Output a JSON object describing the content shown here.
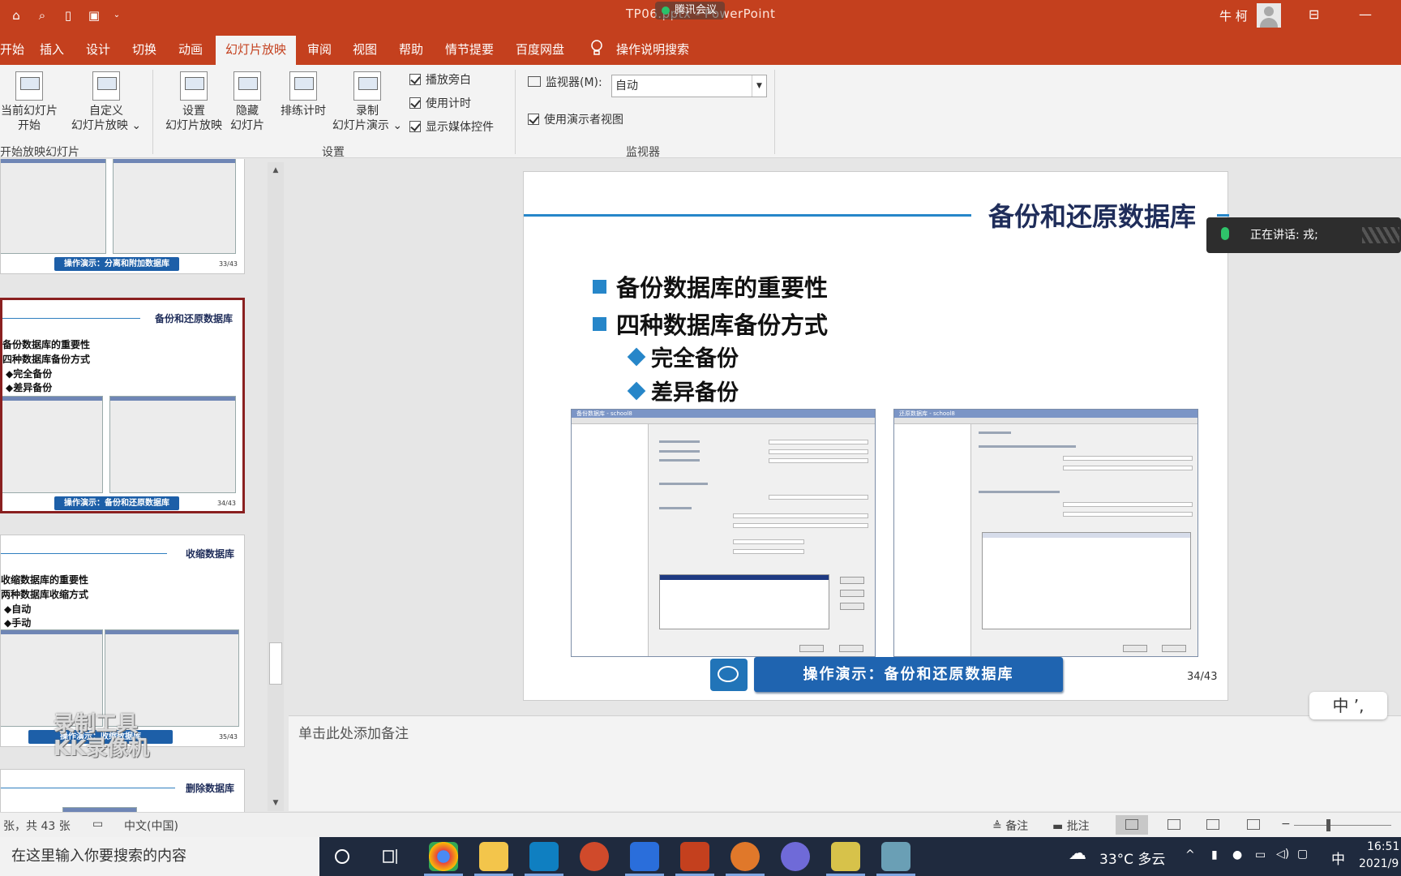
{
  "window": {
    "doc_title": "TP06.pptx - PowerPoint",
    "meeting_label": "腾讯会议",
    "user_name": "牛 柯",
    "quick_access": [
      "slideshow-icon",
      "preview-icon",
      "new-icon",
      "save-icon",
      "customize-icon"
    ]
  },
  "tabs": [
    "开始",
    "插入",
    "设计",
    "切换",
    "动画",
    "幻灯片放映",
    "审阅",
    "视图",
    "帮助",
    "情节提要",
    "百度网盘"
  ],
  "active_tab": "幻灯片放映",
  "tell_me": "操作说明搜索",
  "ribbon": {
    "start_from_current": [
      "当前幻灯片",
      "开始"
    ],
    "custom_show": [
      "自定义",
      "幻灯片放映"
    ],
    "group_start": "开始放映幻灯片",
    "setup_show": [
      "设置",
      "幻灯片放映"
    ],
    "hide_slide": [
      "隐藏",
      "幻灯片"
    ],
    "rehearse": "排练计时",
    "record": [
      "录制",
      "幻灯片演示"
    ],
    "checks": [
      {
        "label": "播放旁白",
        "checked": true
      },
      {
        "label": "使用计时",
        "checked": true
      },
      {
        "label": "显示媒体控件",
        "checked": true
      }
    ],
    "group_setup": "设置",
    "monitor_label": "监视器(M):",
    "monitor_value": "自动",
    "presenter_view": {
      "label": "使用演示者视图",
      "checked": true
    },
    "group_monitor": "监视器"
  },
  "thumbnails": [
    {
      "banner": "操作演示：分离和附加数据库",
      "num": "33/43"
    },
    {
      "title": "备份和还原数据库",
      "bullets": [
        "备份数据库的重要性",
        "四种数据库备份方式"
      ],
      "subs": [
        "完全备份",
        "差异备份"
      ],
      "banner": "操作演示：备份和还原数据库",
      "num": "34/43"
    },
    {
      "title": "收缩数据库",
      "bullets": [
        "收缩数据库的重要性",
        "两种数据库收缩方式"
      ],
      "subs": [
        "自动",
        "手动"
      ],
      "banner": "操作演示：收缩数据库",
      "num": "35/43"
    },
    {
      "title": "删除数据库"
    }
  ],
  "watermark": [
    "录制工具",
    "KK录像机"
  ],
  "slide": {
    "title": "备份和还原数据库",
    "bullets": [
      "备份数据库的重要性",
      "四种数据库备份方式"
    ],
    "subs": [
      "完全备份",
      "差异备份"
    ],
    "shot1_title": "备份数据库 - school8",
    "shot2_title": "还原数据库 - school8",
    "banner": "操作演示：备份和还原数据库",
    "page": "34/43"
  },
  "speaking": "正在讲话: 戎;",
  "ime_indicator": "中 ’,",
  "notes_placeholder": "单击此处添加备注",
  "status": {
    "slide_count": "张，共 43 张",
    "language": "中文(中国)",
    "notes_btn": "备注",
    "comments_btn": "批注"
  },
  "taskbar": {
    "search_placeholder": "在这里输入你要搜索的内容",
    "weather": "33°C  多云",
    "ime": "中",
    "time": "16:51",
    "date": "2021/9"
  }
}
